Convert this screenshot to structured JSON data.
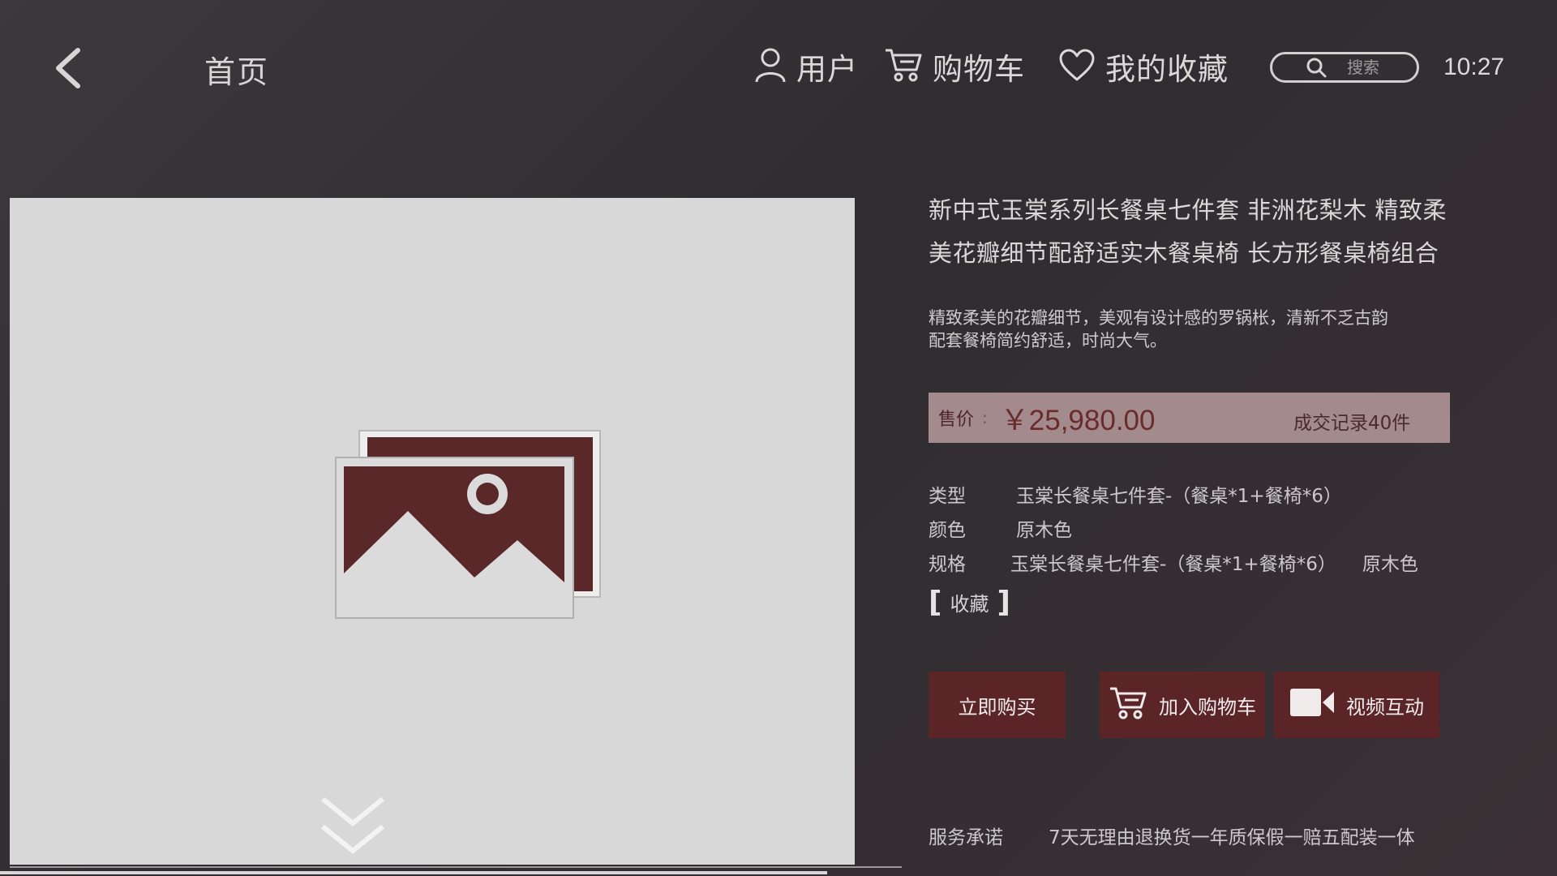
{
  "header": {
    "home_title": "首页",
    "nav": {
      "user": "用户",
      "cart": "购物车",
      "favorites": "我的收藏"
    },
    "search": {
      "placeholder": "搜索"
    },
    "clock": "10:27"
  },
  "product": {
    "title_line1": "新中式玉棠系列长餐桌七件套 非洲花梨木 精致柔",
    "title_line2": "美花瓣细节配舒适实木餐桌椅 长方形餐桌椅组合",
    "desc_line1": "精致柔美的花瓣细节，美观有设计感的罗锅枨，清新不乏古韵",
    "desc_line2": "配套餐椅简约舒适，时尚大气。",
    "price_label": "售价",
    "price_sep": ":",
    "price_value": "￥25,980.00",
    "deal_record": "成交记录40件",
    "specs": {
      "type_key": "类型",
      "type_value": "玉棠长餐桌七件套-（餐桌*1+餐椅*6）",
      "color_key": "颜色",
      "color_value": "原木色",
      "spec_key": "规格",
      "spec_value": "玉棠长餐桌七件套-（餐桌*1+餐椅*6）",
      "spec_value2": "原木色"
    },
    "favorite_label": "收藏",
    "buttons": {
      "buy_now": "立即购买",
      "add_to_cart": "加入购物车",
      "video": "视频互动"
    },
    "service_key": "服务承诺",
    "service_value": "7天无理由退换货一年质保假一赔五配装一体"
  },
  "colors": {
    "accent_dark_red": "#5b2527",
    "price_bar": "#a38a8d",
    "image_bg": "#d9d8d8"
  }
}
